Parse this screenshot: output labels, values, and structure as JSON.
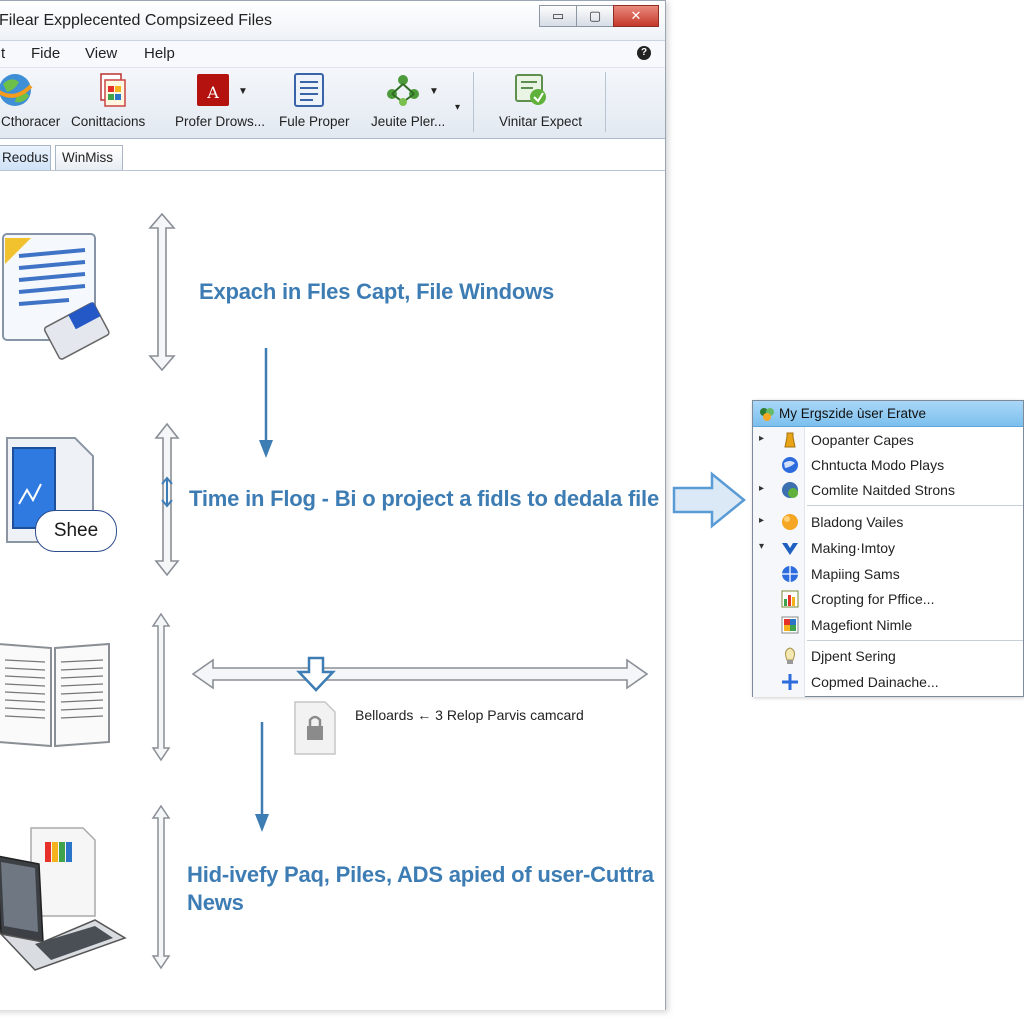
{
  "window": {
    "title": "Filear Expplecented Compsizeed Files",
    "buttons": {
      "minimize": "▭",
      "maximize": "▢",
      "close": "✕"
    }
  },
  "menu": {
    "items": [
      "t",
      "Fide",
      "View",
      "Help"
    ],
    "help_icon": "?"
  },
  "toolbar": {
    "items": [
      {
        "label": "Cthoracer",
        "icon": "globe-icon"
      },
      {
        "label": "Conittacions",
        "icon": "documents-icon"
      },
      {
        "label": "Profer Drows...",
        "icon": "pdf-icon"
      },
      {
        "label": "Fule Proper",
        "icon": "document-icon"
      },
      {
        "label": "Jeuite Pler...",
        "icon": "network-icon"
      },
      {
        "label": "Vinitar Expect",
        "icon": "export-icon"
      }
    ]
  },
  "tabs": [
    "Reodus",
    "WinMiss"
  ],
  "content": {
    "steps": [
      {
        "text": "Expach in Fles Capt, File Windows"
      },
      {
        "text": "Time in Flog - Bi o project a fidls to dedala file",
        "badge": "Shee"
      },
      {
        "text": "Belloards ← 3 Relop Parvis camcard"
      },
      {
        "text": "Hid-ivefy Paq, Piles, ADS apied of user-Cuttra News"
      }
    ]
  },
  "popup": {
    "header": "My Ergszide ùser Eratve",
    "groups": [
      [
        {
          "label": "Oopanter Capes",
          "caret": "▸",
          "icon": "folder-icon"
        },
        {
          "label": "Chntucta Modo Plays",
          "caret": "",
          "icon": "globe-icon"
        },
        {
          "label": "Comlite Naitded Strons",
          "caret": "▸",
          "icon": "network-icon"
        }
      ],
      [
        {
          "label": "Bladong Vailes",
          "caret": "▸",
          "icon": "ball-icon"
        },
        {
          "label": "Making·Imtoy",
          "caret": "▾",
          "icon": "chevron-icon"
        },
        {
          "label": "Mapiing Sams",
          "caret": "",
          "icon": "globe-icon"
        },
        {
          "label": "Cropting for Pffice...",
          "caret": "",
          "icon": "chart-icon"
        },
        {
          "label": "Magefiont Nimle",
          "caret": "",
          "icon": "image-icon"
        }
      ],
      [
        {
          "label": "Djpent Sering",
          "caret": "",
          "icon": "bulb-icon"
        },
        {
          "label": "Copmed Dainache...",
          "caret": "",
          "icon": "plus-icon"
        }
      ]
    ]
  }
}
